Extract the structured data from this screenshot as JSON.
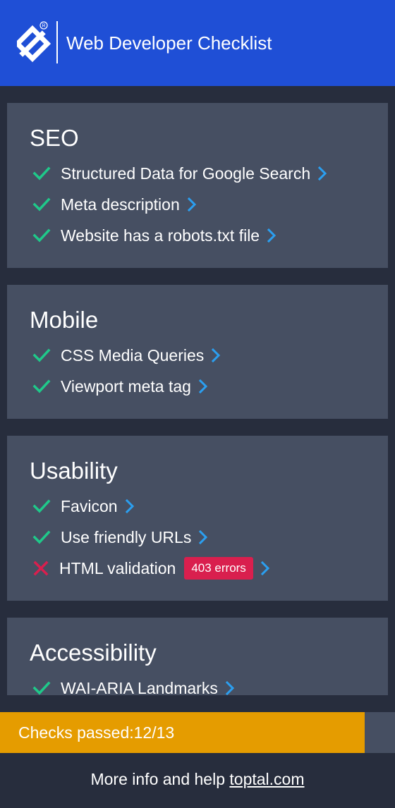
{
  "header": {
    "title": "Web Developer Checklist",
    "brand_color": "#1f4fd6",
    "logo_icon": "toptal-logo-icon"
  },
  "sections": [
    {
      "title": "SEO",
      "items": [
        {
          "label": "Structured Data for Google Search",
          "status": "pass"
        },
        {
          "label": "Meta description",
          "status": "pass"
        },
        {
          "label": "Website has a robots.txt file",
          "status": "pass"
        }
      ]
    },
    {
      "title": "Mobile",
      "items": [
        {
          "label": "CSS Media Queries",
          "status": "pass"
        },
        {
          "label": "Viewport meta tag",
          "status": "pass"
        }
      ]
    },
    {
      "title": "Usability",
      "items": [
        {
          "label": "Favicon",
          "status": "pass"
        },
        {
          "label": "Use friendly URLs",
          "status": "pass"
        },
        {
          "label": "HTML validation",
          "status": "fail",
          "badge": "403 errors"
        }
      ]
    },
    {
      "title": "Accessibility",
      "items": [
        {
          "label": "WAI-ARIA Landmarks",
          "status": "pass"
        }
      ]
    }
  ],
  "progress": {
    "label": "Checks passed:12/13",
    "passed": 12,
    "total": 13,
    "color": "#e59c00"
  },
  "footer": {
    "text": "More info and help",
    "link_text": "toptal.com"
  },
  "colors": {
    "pass": "#1fc98a",
    "fail": "#d91f4e",
    "chevron": "#2b9ff0",
    "card": "#464f62",
    "background": "#272d3d"
  }
}
